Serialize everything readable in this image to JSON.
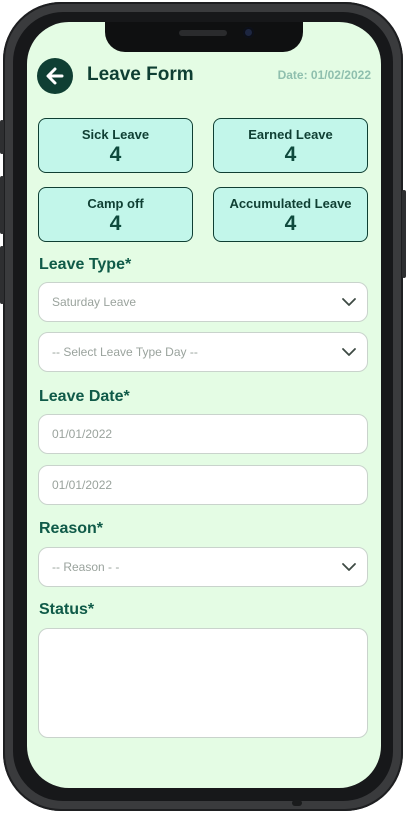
{
  "header": {
    "title": "Leave Form",
    "date": "Date: 01/02/2022"
  },
  "summary": [
    {
      "label": "Sick Leave",
      "value": "4"
    },
    {
      "label": "Earned Leave",
      "value": "4"
    },
    {
      "label": "Camp off",
      "value": "4"
    },
    {
      "label": "Accumulated Leave",
      "value": "4"
    }
  ],
  "leave_type": {
    "label": "Leave Type*",
    "type_value": "Saturday Leave",
    "day_placeholder": "-- Select Leave Type Day --"
  },
  "leave_date": {
    "label": "Leave Date*",
    "from": "01/01/2022",
    "to": "01/01/2022"
  },
  "reason": {
    "label": "Reason*",
    "placeholder": "-- Reason - -"
  },
  "status": {
    "label": "Status*",
    "value": ""
  },
  "colors": {
    "accent": "#0f3f33",
    "card_bg": "#c2f6ea",
    "screen_bg": "#e4fce4"
  },
  "icons": {
    "back": "arrow-left",
    "dropdown": "chevron-down"
  }
}
